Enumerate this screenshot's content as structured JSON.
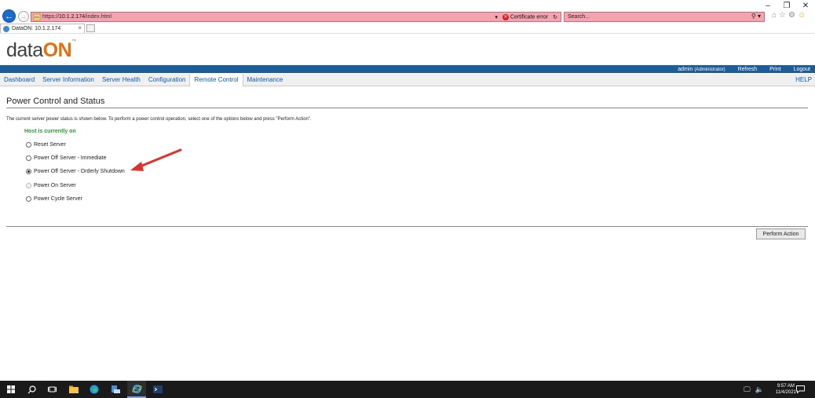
{
  "browser": {
    "url_prefix": "https://",
    "url_host": "10.1.2.174",
    "url_path": "/index.html",
    "cert_error": "Certificate error",
    "search_placeholder": "Search...",
    "tab_title": "DataON: 10.1.2.174",
    "tab_close": "×"
  },
  "window": {
    "minimize": "–",
    "restore": "❐",
    "close": "✕"
  },
  "logo": {
    "part1": "data",
    "part2": "ON",
    "tm": "™"
  },
  "topbar": {
    "user": "admin",
    "role": "(Administrator)",
    "refresh": "Refresh",
    "print": "Print",
    "logout": "Logout"
  },
  "nav": {
    "items": [
      "Dashboard",
      "Server Information",
      "Server Health",
      "Configuration",
      "Remote Control",
      "Maintenance"
    ],
    "active": "Remote Control",
    "help": "HELP"
  },
  "page": {
    "title": "Power Control and Status",
    "description": "The current server power status is shown below. To perform a power control operation, select one of the options below and press \"Perform Action\".",
    "host_status": "Host is currently on",
    "options": [
      {
        "label": "Reset Server",
        "state": "unchecked"
      },
      {
        "label": "Power Off Server - Immediate",
        "state": "unchecked"
      },
      {
        "label": "Power Off Server - Orderly Shutdown",
        "state": "checked"
      },
      {
        "label": "Power On Server",
        "state": "disabled"
      },
      {
        "label": "Power Cycle Server",
        "state": "unchecked"
      }
    ],
    "perform_button": "Perform Action",
    "annotation_arrow_color": "#e0302a"
  },
  "taskbar": {
    "time": "9:57 AM",
    "date": "11/4/2021"
  }
}
